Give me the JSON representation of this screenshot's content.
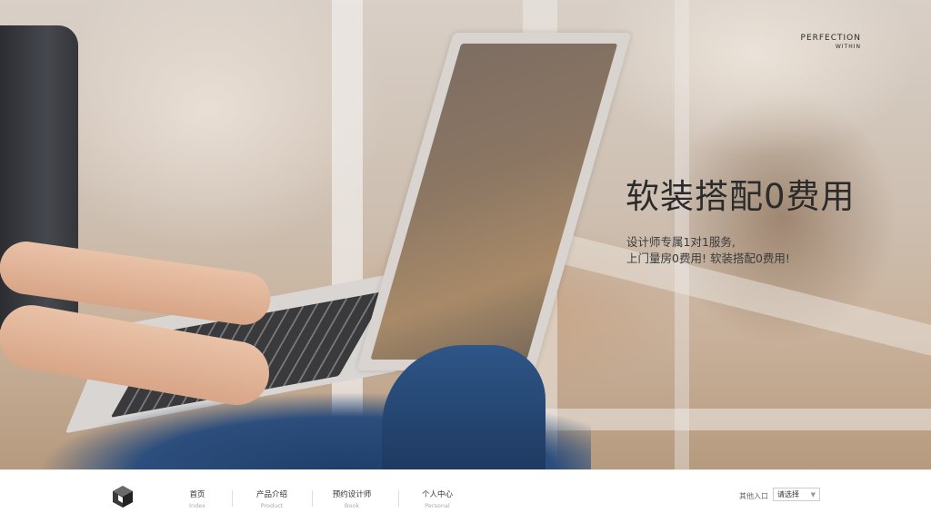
{
  "brand": {
    "line1": "PERFECTION",
    "line2": "WITHIN"
  },
  "hero": {
    "headline": "软装搭配0费用",
    "subline1": "设计师专属1对1服务,",
    "subline2": "上门量房0费用! 软装搭配0费用!"
  },
  "footer": {
    "logo_icon": "cube-logo-icon",
    "nav": [
      {
        "zh": "首页",
        "en": "Index"
      },
      {
        "zh": "产品介绍",
        "en": "Product"
      },
      {
        "zh": "预约设计师",
        "en": "Book"
      },
      {
        "zh": "个人中心",
        "en": "Personal"
      }
    ],
    "other_entry_label": "其他入口",
    "select": {
      "value": "请选择"
    }
  }
}
